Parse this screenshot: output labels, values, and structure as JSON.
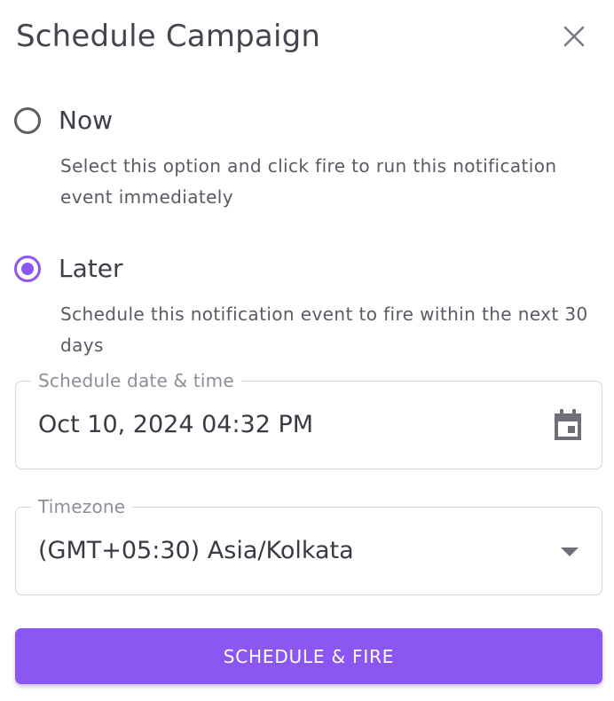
{
  "dialog": {
    "title": "Schedule Campaign",
    "close_icon": "close-icon"
  },
  "options": {
    "now": {
      "label": "Now",
      "description": "Select this option and click fire to run this notification event immediately",
      "selected": false
    },
    "later": {
      "label": "Later",
      "description": "Schedule this notification event to fire within the next 30 days",
      "selected": true
    }
  },
  "schedule_field": {
    "label": "Schedule date & time",
    "value": "Oct 10, 2024 04:32 PM",
    "icon": "calendar-icon"
  },
  "timezone_field": {
    "label": "Timezone",
    "value": "(GMT+05:30) Asia/Kolkata",
    "icon": "chevron-down-icon"
  },
  "submit": {
    "label": "SCHEDULE & FIRE"
  },
  "colors": {
    "accent": "#8b56f2",
    "text": "#3a3a44",
    "muted": "#8e8e98",
    "border": "#d4d4da"
  }
}
